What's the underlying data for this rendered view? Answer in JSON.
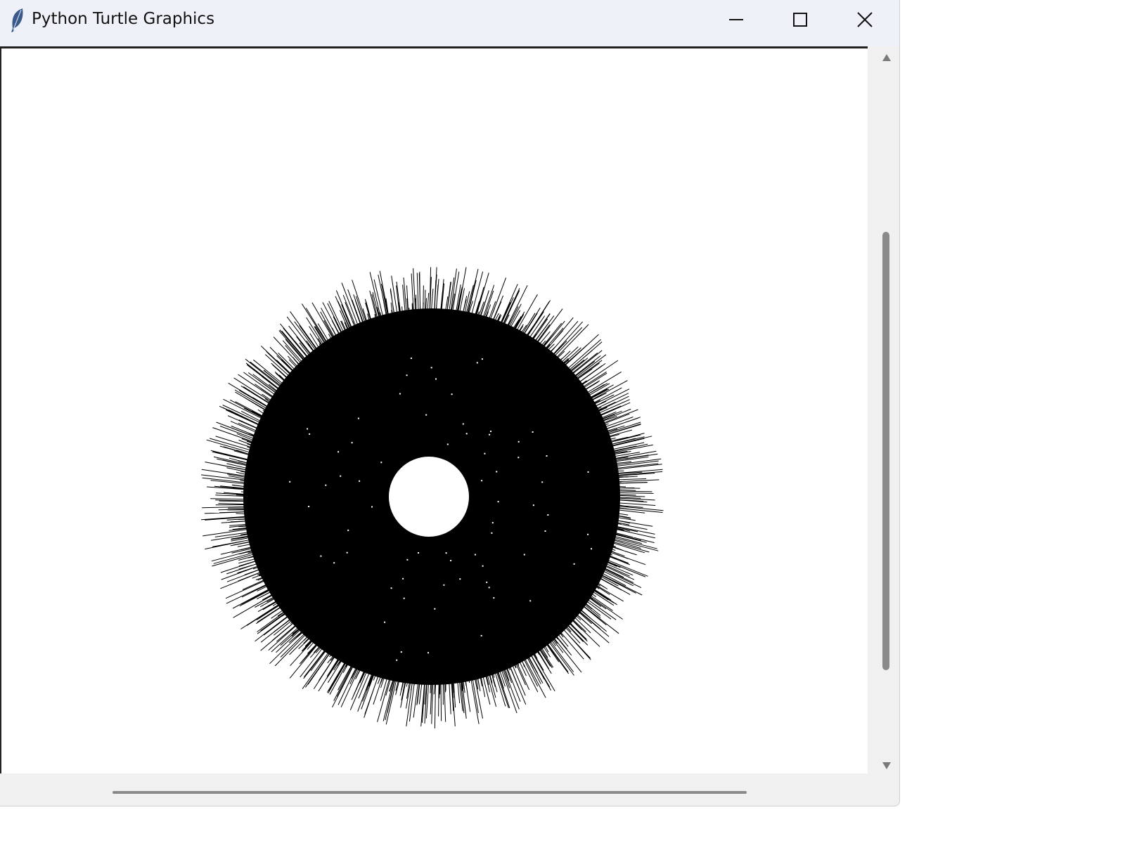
{
  "window": {
    "title": "Python Turtle Graphics",
    "icon": "feather-icon",
    "controls": {
      "minimize_icon": "minimize-icon",
      "maximize_icon": "maximize-icon",
      "close_icon": "close-icon"
    }
  },
  "canvas": {
    "background": "#ffffff",
    "ink": "#000000"
  },
  "scrollbars": {
    "vertical": {
      "up_icon": "arrow-up-icon",
      "down_icon": "arrow-down-icon",
      "position_fraction": 0.25,
      "visible_fraction": 0.6
    },
    "horizontal": {
      "position_fraction": 0.13,
      "visible_fraction": 0.73
    }
  }
}
